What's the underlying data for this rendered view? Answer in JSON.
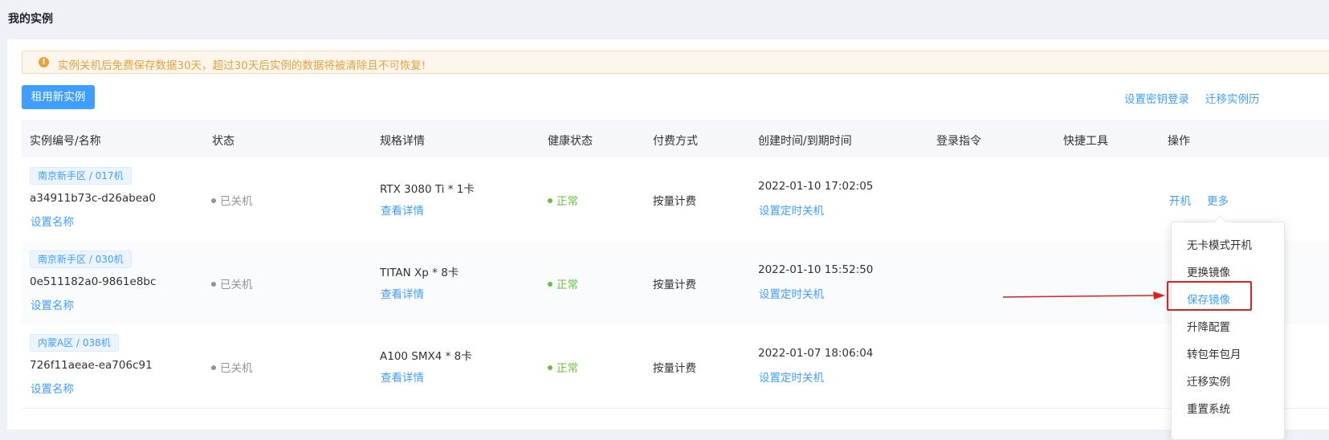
{
  "page": {
    "title": "我的实例"
  },
  "alert": {
    "text": "实例关机后免费保存数据30天，超过30天后实例的数据将被清除且不可恢复!",
    "icon": "exclamation-circle-icon"
  },
  "toolbar": {
    "rent_button": "租用新实例",
    "links": [
      "设置密钥登录",
      "迁移实例历"
    ]
  },
  "table": {
    "headers": [
      "实例编号/名称",
      "状态",
      "规格详情",
      "健康状态",
      "付费方式",
      "创建时间/到期时间",
      "登录指令",
      "快捷工具",
      "操作"
    ],
    "rows": [
      {
        "region": "南京新手区 / 017机",
        "id": "a34911b73c-d26abea0",
        "set_name": "设置名称",
        "status": "已关机",
        "spec": "RTX 3080 Ti * 1卡",
        "view_detail": "查看详情",
        "health": "正常",
        "billing": "按量计费",
        "created": "2022-01-10 17:02:05",
        "timer": "设置定时关机",
        "actions": [
          "开机",
          "更多"
        ]
      },
      {
        "region": "南京新手区 / 030机",
        "id": "0e511182a0-9861e8bc",
        "set_name": "设置名称",
        "status": "已关机",
        "spec": "TITAN Xp * 8卡",
        "view_detail": "查看详情",
        "health": "正常",
        "billing": "按量计费",
        "created": "2022-01-10 15:52:50",
        "timer": "设置定时关机"
      },
      {
        "region": "内蒙A区 / 038机",
        "id": "726f11aeae-ea706c91",
        "set_name": "设置名称",
        "status": "已关机",
        "spec": "A100 SMX4 * 8卡",
        "view_detail": "查看详情",
        "health": "正常",
        "billing": "按量计费",
        "created": "2022-01-07 18:06:04",
        "timer": "设置定时关机"
      }
    ]
  },
  "dropdown": {
    "items": [
      "无卡模式开机",
      "更换镜像",
      "保存镜像",
      "升降配置",
      "转包年包月",
      "迁移实例",
      "重置系统"
    ],
    "highlighted": "保存镜像"
  },
  "colors": {
    "primary": "#409eff",
    "warning": "#e6a23c",
    "success": "#67c23a",
    "annotation": "#e02020"
  }
}
